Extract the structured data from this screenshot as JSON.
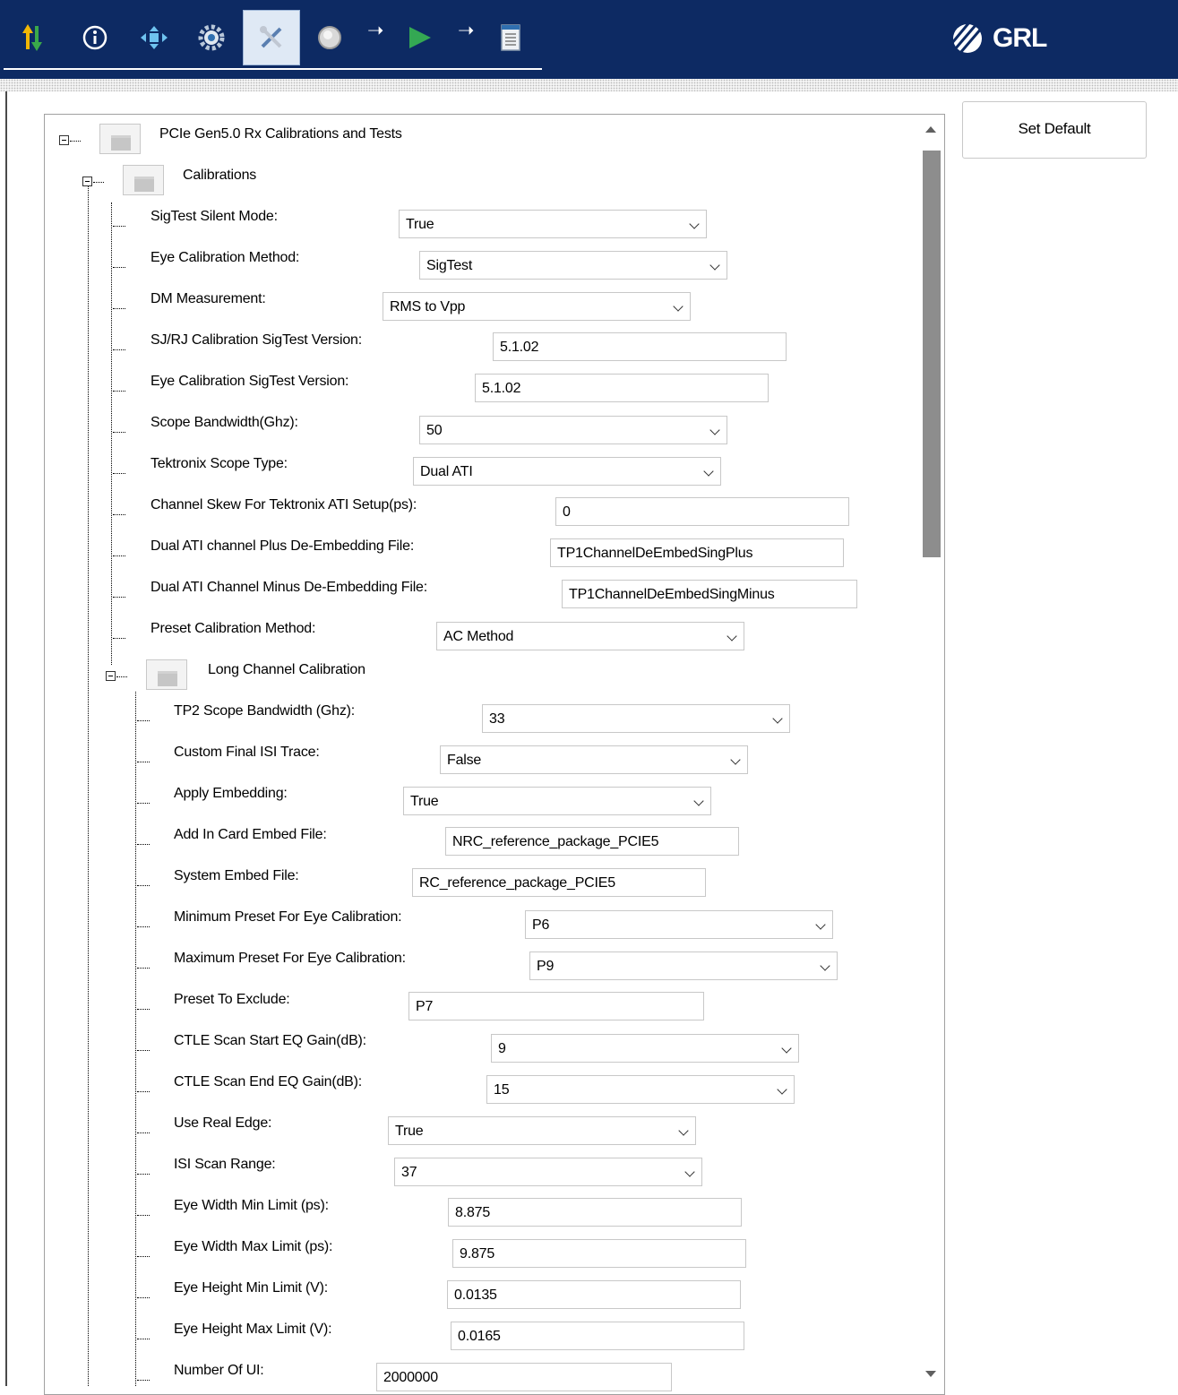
{
  "toolbar": {
    "icons": [
      "sync-arrows-icon",
      "info-icon",
      "connection-icon",
      "gear-icon",
      "tools-icon",
      "power-icon",
      "arrow-right-icon",
      "play-icon",
      "arrow-right-icon",
      "report-icon"
    ],
    "active_tool": "tools-icon",
    "logo_text": "GRL"
  },
  "set_default_label": "Set Default",
  "tree": {
    "root_label": "PCIe Gen5.0 Rx Calibrations and Tests",
    "calibrations_label": "Calibrations",
    "long_channel_label": "Long Channel Calibration",
    "calibration_props": [
      {
        "label": "SigTest Silent Mode:",
        "value": "True",
        "type": "dropdown"
      },
      {
        "label": "Eye Calibration Method:",
        "value": "SigTest",
        "type": "dropdown"
      },
      {
        "label": "DM Measurement:",
        "value": "RMS to Vpp",
        "type": "dropdown"
      },
      {
        "label": "SJ/RJ Calibration SigTest Version:",
        "value": "5.1.02",
        "type": "text"
      },
      {
        "label": "Eye Calibration SigTest Version:",
        "value": "5.1.02",
        "type": "text"
      },
      {
        "label": "Scope Bandwidth(Ghz):",
        "value": "50",
        "type": "dropdown"
      },
      {
        "label": "Tektronix Scope Type:",
        "value": "Dual ATI",
        "type": "dropdown"
      },
      {
        "label": "Channel Skew For Tektronix ATI Setup(ps):",
        "value": "0",
        "type": "text"
      },
      {
        "label": "Dual ATI channel Plus De-Embedding File:",
        "value": "TP1ChannelDeEmbedSingPlus",
        "type": "text"
      },
      {
        "label": "Dual ATI Channel Minus De-Embedding File:",
        "value": "TP1ChannelDeEmbedSingMinus",
        "type": "text"
      },
      {
        "label": "Preset Calibration Method:",
        "value": "AC Method",
        "type": "dropdown"
      }
    ],
    "long_channel_props": [
      {
        "label": "TP2 Scope Bandwidth (Ghz):",
        "value": "33",
        "type": "dropdown"
      },
      {
        "label": "Custom Final ISI Trace:",
        "value": "False",
        "type": "dropdown"
      },
      {
        "label": "Apply Embedding:",
        "value": "True",
        "type": "dropdown"
      },
      {
        "label": "Add In Card Embed File:",
        "value": "NRC_reference_package_PCIE5",
        "type": "text"
      },
      {
        "label": "System Embed File:",
        "value": "RC_reference_package_PCIE5",
        "type": "text"
      },
      {
        "label": "Minimum Preset For Eye Calibration:",
        "value": "P6",
        "type": "dropdown"
      },
      {
        "label": "Maximum Preset For Eye Calibration:",
        "value": "P9",
        "type": "dropdown"
      },
      {
        "label": "Preset To Exclude:",
        "value": "P7",
        "type": "text"
      },
      {
        "label": "CTLE Scan Start EQ Gain(dB):",
        "value": "9",
        "type": "dropdown"
      },
      {
        "label": "CTLE Scan End EQ Gain(dB):",
        "value": "15",
        "type": "dropdown"
      },
      {
        "label": "Use Real Edge:",
        "value": "True",
        "type": "dropdown"
      },
      {
        "label": "ISI Scan Range:",
        "value": "37",
        "type": "dropdown"
      },
      {
        "label": "Eye Width Min Limit (ps):",
        "value": "8.875",
        "type": "text"
      },
      {
        "label": "Eye Width Max Limit (ps):",
        "value": "9.875",
        "type": "text"
      },
      {
        "label": "Eye Height Min Limit (V):",
        "value": "0.0135",
        "type": "text"
      },
      {
        "label": "Eye Height Max Limit (V):",
        "value": "0.0165",
        "type": "text"
      },
      {
        "label": "Number Of UI:",
        "value": "2000000",
        "type": "text"
      }
    ]
  }
}
